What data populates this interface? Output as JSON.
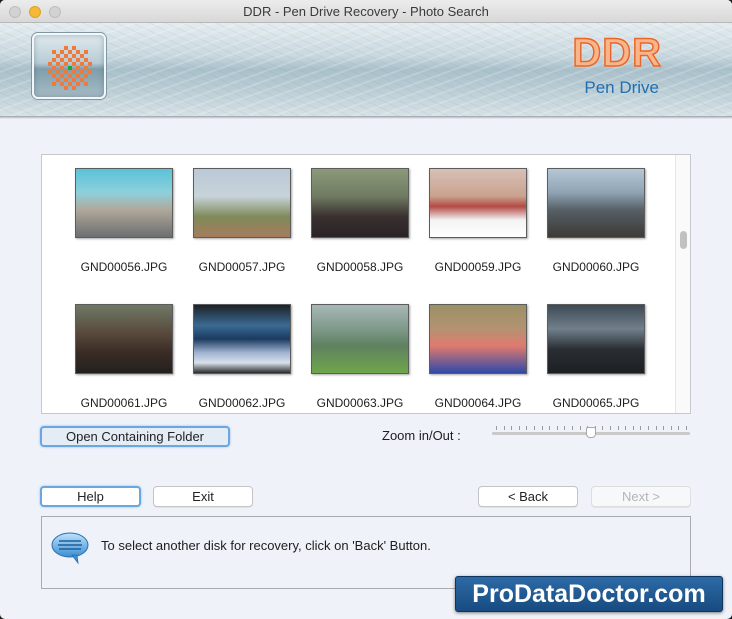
{
  "window": {
    "title": "DDR - Pen Drive Recovery - Photo Search"
  },
  "banner": {
    "brand": "DDR",
    "product": "Pen Drive",
    "logo_icon": "ddr-checker-logo-icon"
  },
  "gallery": {
    "items": [
      {
        "filename": "GND00056.JPG",
        "scene": "woman-at-amusement-park"
      },
      {
        "filename": "GND00057.JPG",
        "scene": "two-women-on-hill"
      },
      {
        "filename": "GND00058.JPG",
        "scene": "couple-selfie-in-park"
      },
      {
        "filename": "GND00059.JPG",
        "scene": "snowy-village-street"
      },
      {
        "filename": "GND00060.JPG",
        "scene": "hiker-on-mountain"
      },
      {
        "filename": "GND00061.JPG",
        "scene": "woman-hair-flip"
      },
      {
        "filename": "GND00062.JPG",
        "scene": "lake-with-trees"
      },
      {
        "filename": "GND00063.JPG",
        "scene": "hiker-on-valley-cliff"
      },
      {
        "filename": "GND00064.JPG",
        "scene": "two-women-with-mugs"
      },
      {
        "filename": "GND00065.JPG",
        "scene": "friends-taking-selfie"
      }
    ],
    "scroll_position": 0.3
  },
  "controls": {
    "open_folder_label": "Open Containing Folder",
    "zoom_label": "Zoom in/Out :",
    "zoom_value": 0.5
  },
  "nav": {
    "help_label": "Help",
    "exit_label": "Exit",
    "back_label": "< Back",
    "next_label": "Next >"
  },
  "status": {
    "message": "To select another disk for recovery, click on 'Back' Button.",
    "icon": "speech-bubble-icon"
  },
  "watermark": {
    "text": "ProDataDoctor.com"
  },
  "colors": {
    "brand_orange": "#e8662a",
    "brand_blue": "#1f6fb2",
    "badge_blue": "#1f5a94",
    "focus_ring": "#6aa6e0"
  }
}
